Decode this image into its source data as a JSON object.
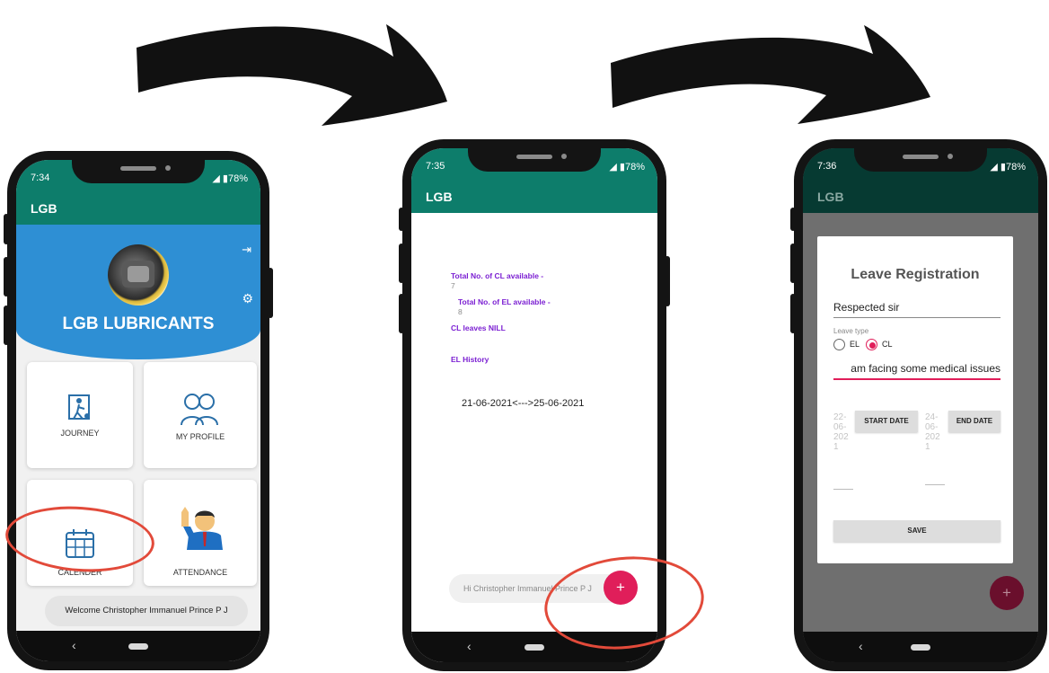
{
  "phone1": {
    "status_time": "7:34",
    "battery": "78%",
    "appbar_title": "LGB",
    "brand_name": "LGB LUBRICANTS",
    "tiles": [
      {
        "label": "JOURNEY",
        "icon": "journey-icon"
      },
      {
        "label": "MY PROFILE",
        "icon": "profile-icon"
      },
      {
        "label": "CALENDER",
        "icon": "calendar-icon"
      },
      {
        "label": "ATTENDANCE",
        "icon": "attendance-icon"
      }
    ],
    "welcome_text": "Welcome Christopher Immanuel Prince P J"
  },
  "phone2": {
    "status_time": "7:35",
    "battery": "78%",
    "appbar_title": "LGB",
    "cl_available_label": "Total No. of CL available -",
    "cl_available_value": "7",
    "el_available_label": "Total No. of EL available -",
    "el_available_value": "8",
    "cl_leaves_text": "CL leaves NILL",
    "el_history_label": "EL History",
    "el_history_entry": "21-06-2021<--->25-06-2021",
    "greeting": "Hi Christopher Immanuel Prince P J",
    "fab_symbol": "+"
  },
  "phone3": {
    "status_time": "7:36",
    "battery": "78%",
    "appbar_title": "LGB",
    "dialog_title": "Leave Registration",
    "salutation": "Respected sir",
    "leave_type_label": "Leave type",
    "options": [
      "EL",
      "CL"
    ],
    "selected_option": "CL",
    "reason_text": "am facing some medical issues",
    "start_date_value": "22-\n06-\n202\n1",
    "start_date_button": "START DATE",
    "end_date_value": "24-\n06-\n202\n1",
    "end_date_button": "END DATE",
    "save_button": "SAVE",
    "fab_symbol": "+"
  },
  "colors": {
    "teal": "#0d7d6b",
    "brand_blue": "#2e8fd4",
    "purple_text": "#7b1fd2",
    "fab_pink": "#e01e5a",
    "highlight_red": "#e24a3a"
  }
}
